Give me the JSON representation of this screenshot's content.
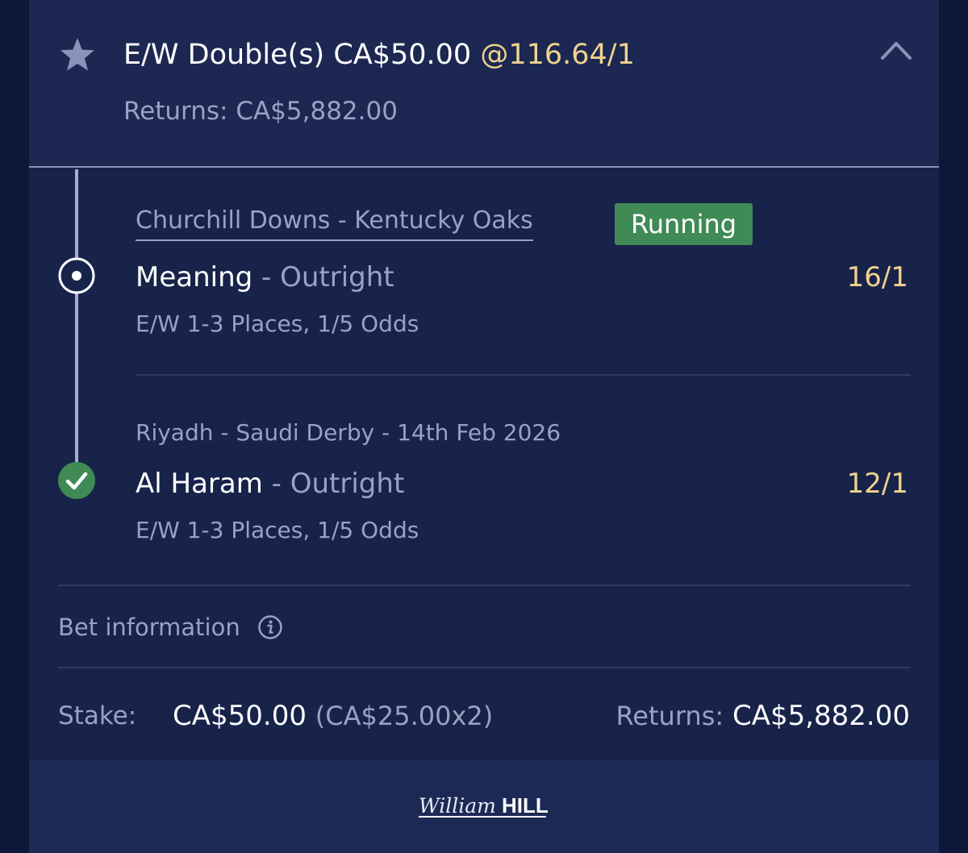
{
  "header": {
    "bet_type": "E/W Double(s) CA$50.00",
    "odds": "@116.64/1",
    "returns": "Returns: CA$5,882.00"
  },
  "legs": [
    {
      "event": "Churchill Downs - Kentucky Oaks",
      "status": "Running",
      "selection": "Meaning",
      "market": " - Outright",
      "odds": "16/1",
      "terms": "E/W 1-3 Places, 1/5 Odds",
      "state_icon": "radio-icon"
    },
    {
      "event": "Riyadh - Saudi Derby - 14th Feb 2026",
      "selection": "Al Haram",
      "market": " - Outright",
      "odds": "12/1",
      "terms": "E/W 1-3 Places, 1/5 Odds",
      "state_icon": "check-icon"
    }
  ],
  "bet_information": {
    "label": "Bet information"
  },
  "footer": {
    "stake_label": "Stake:",
    "stake_value": "CA$50.00",
    "stake_split": "(CA$25.00x2)",
    "returns_label": "Returns:",
    "returns_value": "CA$5,882.00"
  },
  "brand": {
    "logo_script": "William",
    "logo_bold": "HILL"
  },
  "colors": {
    "background": "#0d1838",
    "card": "#1a2550",
    "odds": "#efd28e",
    "status_running": "#3f8a55",
    "win_check": "#3f8a55",
    "muted_text": "#9aa2c3"
  }
}
